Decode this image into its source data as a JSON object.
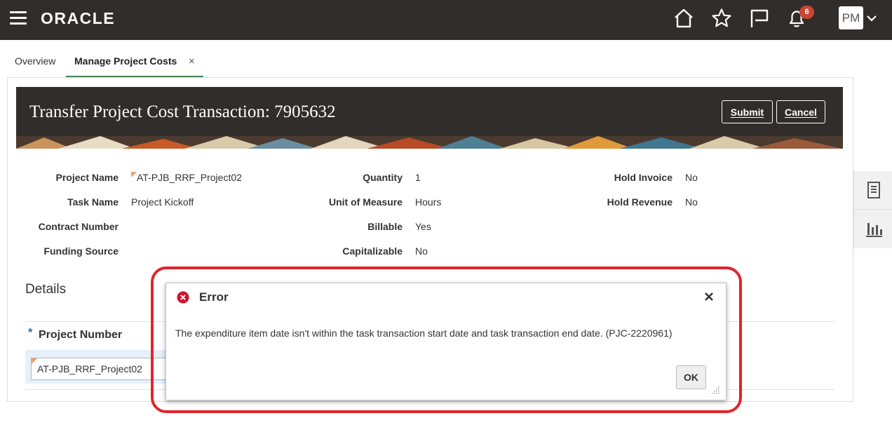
{
  "header": {
    "logo": "ORACLE",
    "notifications_count": "6",
    "avatar_initials": "PM"
  },
  "tabs": {
    "overview_label": "Overview",
    "manage_label": "Manage Project Costs",
    "close_glyph": "×"
  },
  "page": {
    "title": "Transfer Project Cost Transaction: 7905632",
    "submit_label": "Submit",
    "cancel_label": "Cancel"
  },
  "fields": {
    "project_name": {
      "label": "Project Name",
      "value": "AT-PJB_RRF_Project02"
    },
    "task_name": {
      "label": "Task Name",
      "value": "Project Kickoff"
    },
    "contract_number": {
      "label": "Contract Number",
      "value": ""
    },
    "funding_source": {
      "label": "Funding Source",
      "value": ""
    },
    "quantity": {
      "label": "Quantity",
      "value": "1"
    },
    "unit_of_measure": {
      "label": "Unit of Measure",
      "value": "Hours"
    },
    "billable": {
      "label": "Billable",
      "value": "Yes"
    },
    "capitalizable": {
      "label": "Capitalizable",
      "value": "No"
    },
    "hold_invoice": {
      "label": "Hold Invoice",
      "value": "No"
    },
    "hold_revenue": {
      "label": "Hold Revenue",
      "value": "No"
    }
  },
  "details": {
    "title": "Details",
    "required_marker": "*",
    "project_number_label": "Project Number",
    "project_number_value": "AT-PJB_RRF_Project02"
  },
  "dialog": {
    "title": "Error",
    "message": "The expenditure item date isn't within the task transaction start date and task transaction end date. (PJC-2220961)",
    "ok_label": "OK"
  },
  "colors": {
    "header_bg": "#312d2a",
    "error_red": "#e1242c",
    "badge_red": "#c74634",
    "tab_underline": "#4b8558"
  }
}
